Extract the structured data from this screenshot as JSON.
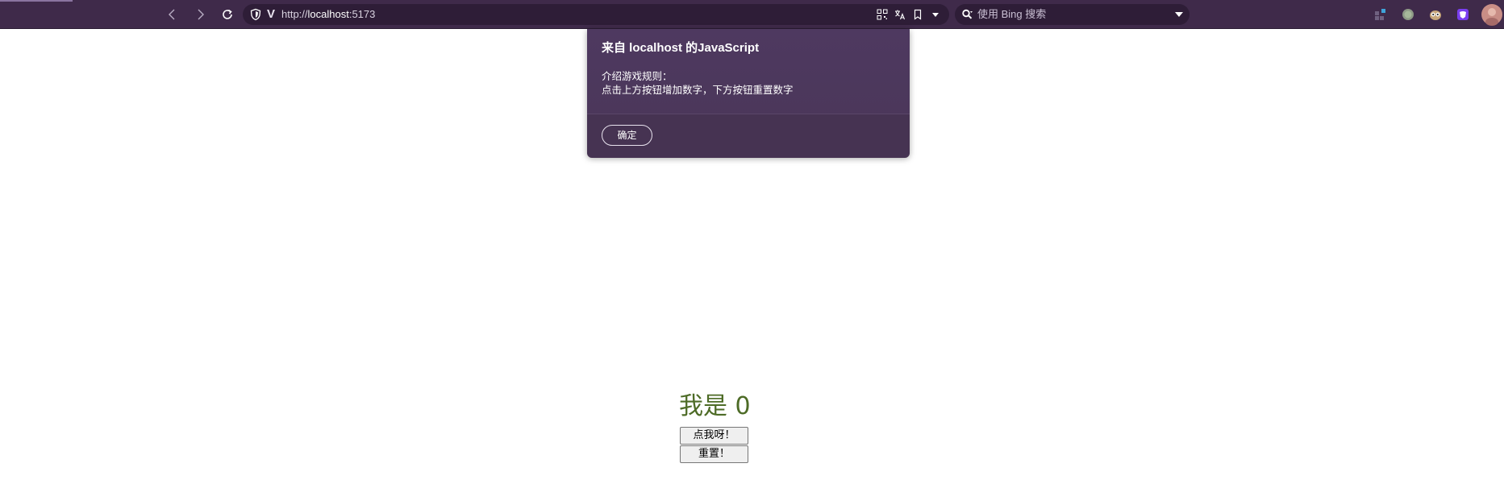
{
  "browser": {
    "url_prefix": "http://",
    "url_host": "localhost",
    "url_suffix": ":5173",
    "search_placeholder": "使用 Bing 搜索"
  },
  "dialog": {
    "title": "来自 localhost 的JavaScript",
    "message": "介绍游戏规则：\n点击上方按钮增加数字，下方按钮重置数字",
    "ok_label": "确定"
  },
  "page": {
    "counter_prefix": "我是",
    "counter_value": "0",
    "increment_label": "点我呀！",
    "reset_label": "重置！"
  },
  "colors": {
    "toolbar": "#3f2a4a",
    "dialog": "#4e3960",
    "counter_text": "#4d6b26"
  }
}
